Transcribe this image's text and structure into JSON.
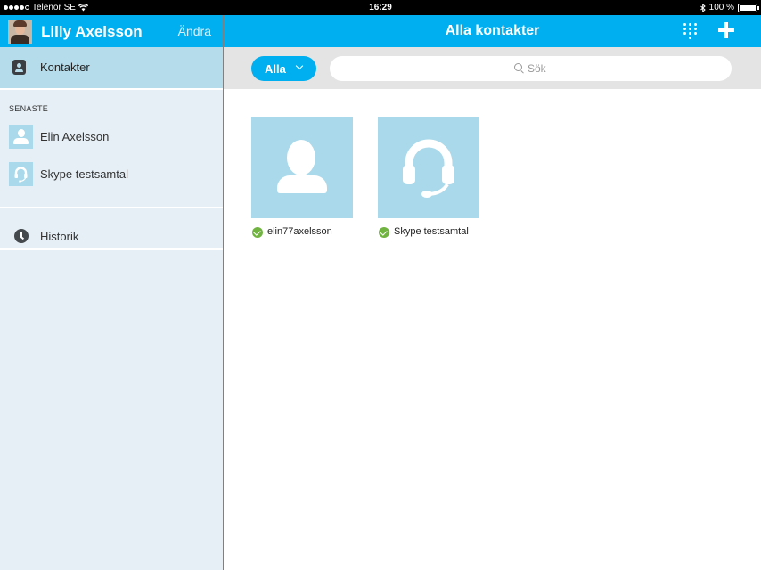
{
  "status_bar": {
    "carrier": "Telenor SE",
    "time": "16:29",
    "battery": "100 %"
  },
  "profile": {
    "name": "Lilly Axelsson",
    "edit_label": "Ändra"
  },
  "sidebar": {
    "contacts_label": "Kontakter",
    "recent_section_title": "SENASTE",
    "recent": [
      {
        "label": "Elin Axelsson",
        "icon": "person-icon"
      },
      {
        "label": "Skype testsamtal",
        "icon": "headset-icon"
      }
    ],
    "history_label": "Historik"
  },
  "main": {
    "title": "Alla kontakter",
    "filter_label": "Alla",
    "search_placeholder": "Sök",
    "contacts": [
      {
        "name": "elin77axelsson",
        "icon": "person-icon",
        "status": "online"
      },
      {
        "name": "Skype testsamtal",
        "icon": "headset-icon",
        "status": "online"
      }
    ]
  },
  "colors": {
    "accent": "#00aff0",
    "sidebar_bg": "#e6eff5",
    "selected_bg": "#b5dcea",
    "tile_bg": "#a9d9ea",
    "online": "#71b340"
  }
}
